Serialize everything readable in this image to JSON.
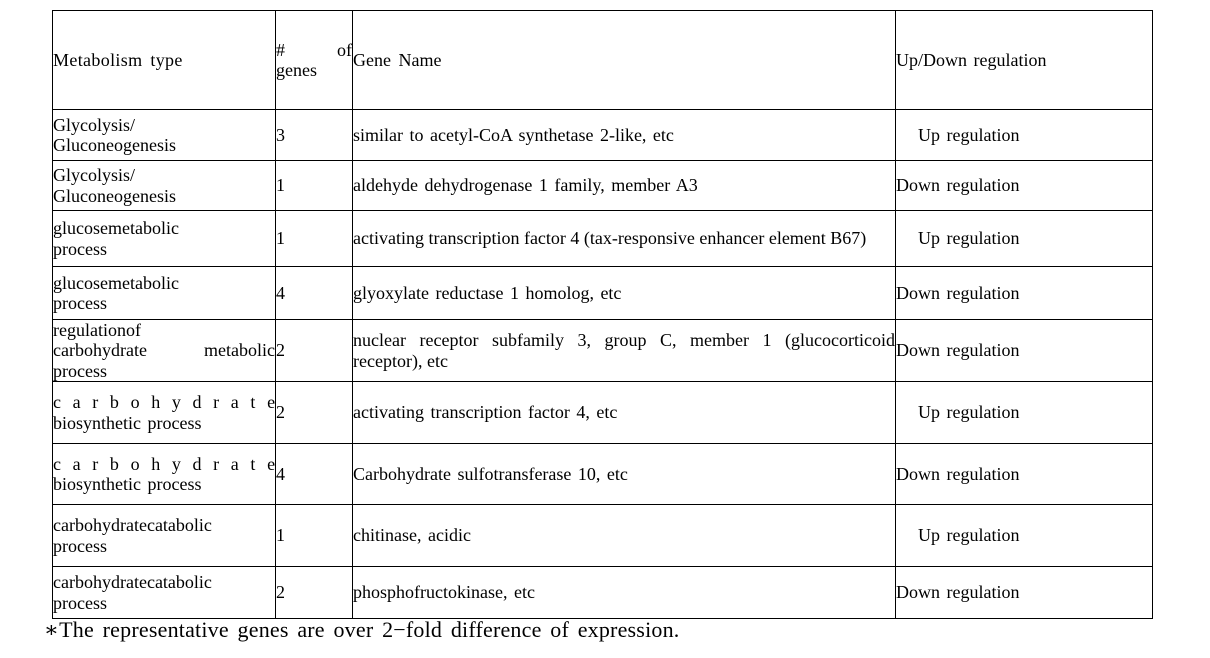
{
  "table": {
    "columns": [
      {
        "key": "type",
        "label": "Metabolism type"
      },
      {
        "key": "num",
        "label_line1": "#  of",
        "label_line2": "genes"
      },
      {
        "key": "gene",
        "label": "Gene Name"
      },
      {
        "key": "reg",
        "label": "Up/Down regulation"
      }
    ],
    "rows": [
      {
        "type_line1": "Glycolysis",
        "type_line2": "/",
        "type_line3": "Gluconeogenesis",
        "type_plain": "Glycolysis / Gluconeogenesis",
        "num": "3",
        "gene": "similar to acetyl-CoA synthetase 2-like, etc",
        "regulation": "Up regulation"
      },
      {
        "type_line1": "Glycolysis",
        "type_line2": "/",
        "type_line3": "Gluconeogenesis",
        "type_plain": "Glycolysis / Gluconeogenesis",
        "num": "1",
        "gene": "aldehyde dehydrogenase 1 family, member A3",
        "regulation": "Down regulation"
      },
      {
        "type_line1": "glucose",
        "type_line2": "metabolic",
        "type_line3": "process",
        "type_plain": "glucose metabolic process",
        "num": "1",
        "gene": "activating transcription factor 4 (tax-responsive enhancer element B67)",
        "regulation": "Up regulation"
      },
      {
        "type_line1": "glucose",
        "type_line2": "metabolic",
        "type_line3": "process",
        "type_plain": "glucose metabolic process",
        "num": "4",
        "gene": "glyoxylate reductase 1 homolog, etc",
        "regulation": "Down regulation"
      },
      {
        "type_line1": "regulation",
        "type_line2": "of",
        "type_line3": "carbohydrate metabolic",
        "type_line4": "process",
        "type_plain": "regulation of carbohydrate metabolic process",
        "num": "2",
        "gene": "nuclear receptor subfamily 3, group C, member 1 (glucocorticoid receptor), etc",
        "regulation": "Down regulation"
      },
      {
        "type_spread": "carbohydrate",
        "type_line_last": "biosynthetic process",
        "type_plain": "carbohydrate biosynthetic process",
        "num": "2",
        "gene": "activating transcription factor 4, etc",
        "regulation": "Up regulation"
      },
      {
        "type_spread": "carbohydrate",
        "type_line_last": "biosynthetic process",
        "type_plain": "carbohydrate biosynthetic process",
        "num": "4",
        "gene": "Carbohydrate sulfotransferase 10, etc",
        "regulation": "Down regulation"
      },
      {
        "type_line1": "carbohydrate",
        "type_line2": "catabolic",
        "type_line3": "process",
        "type_plain": "carbohydrate catabolic process",
        "num": "1",
        "gene": "chitinase, acidic",
        "regulation": "Up regulation"
      },
      {
        "type_line1": "carbohydrate",
        "type_line2": "catabolic",
        "type_line3": "process",
        "type_plain": "carbohydrate catabolic process",
        "num": "2",
        "gene": "phosphofructokinase, etc",
        "regulation": "Down regulation"
      }
    ]
  },
  "footnote": {
    "text": "∗The representative genes are over 2−fold difference of expression."
  }
}
